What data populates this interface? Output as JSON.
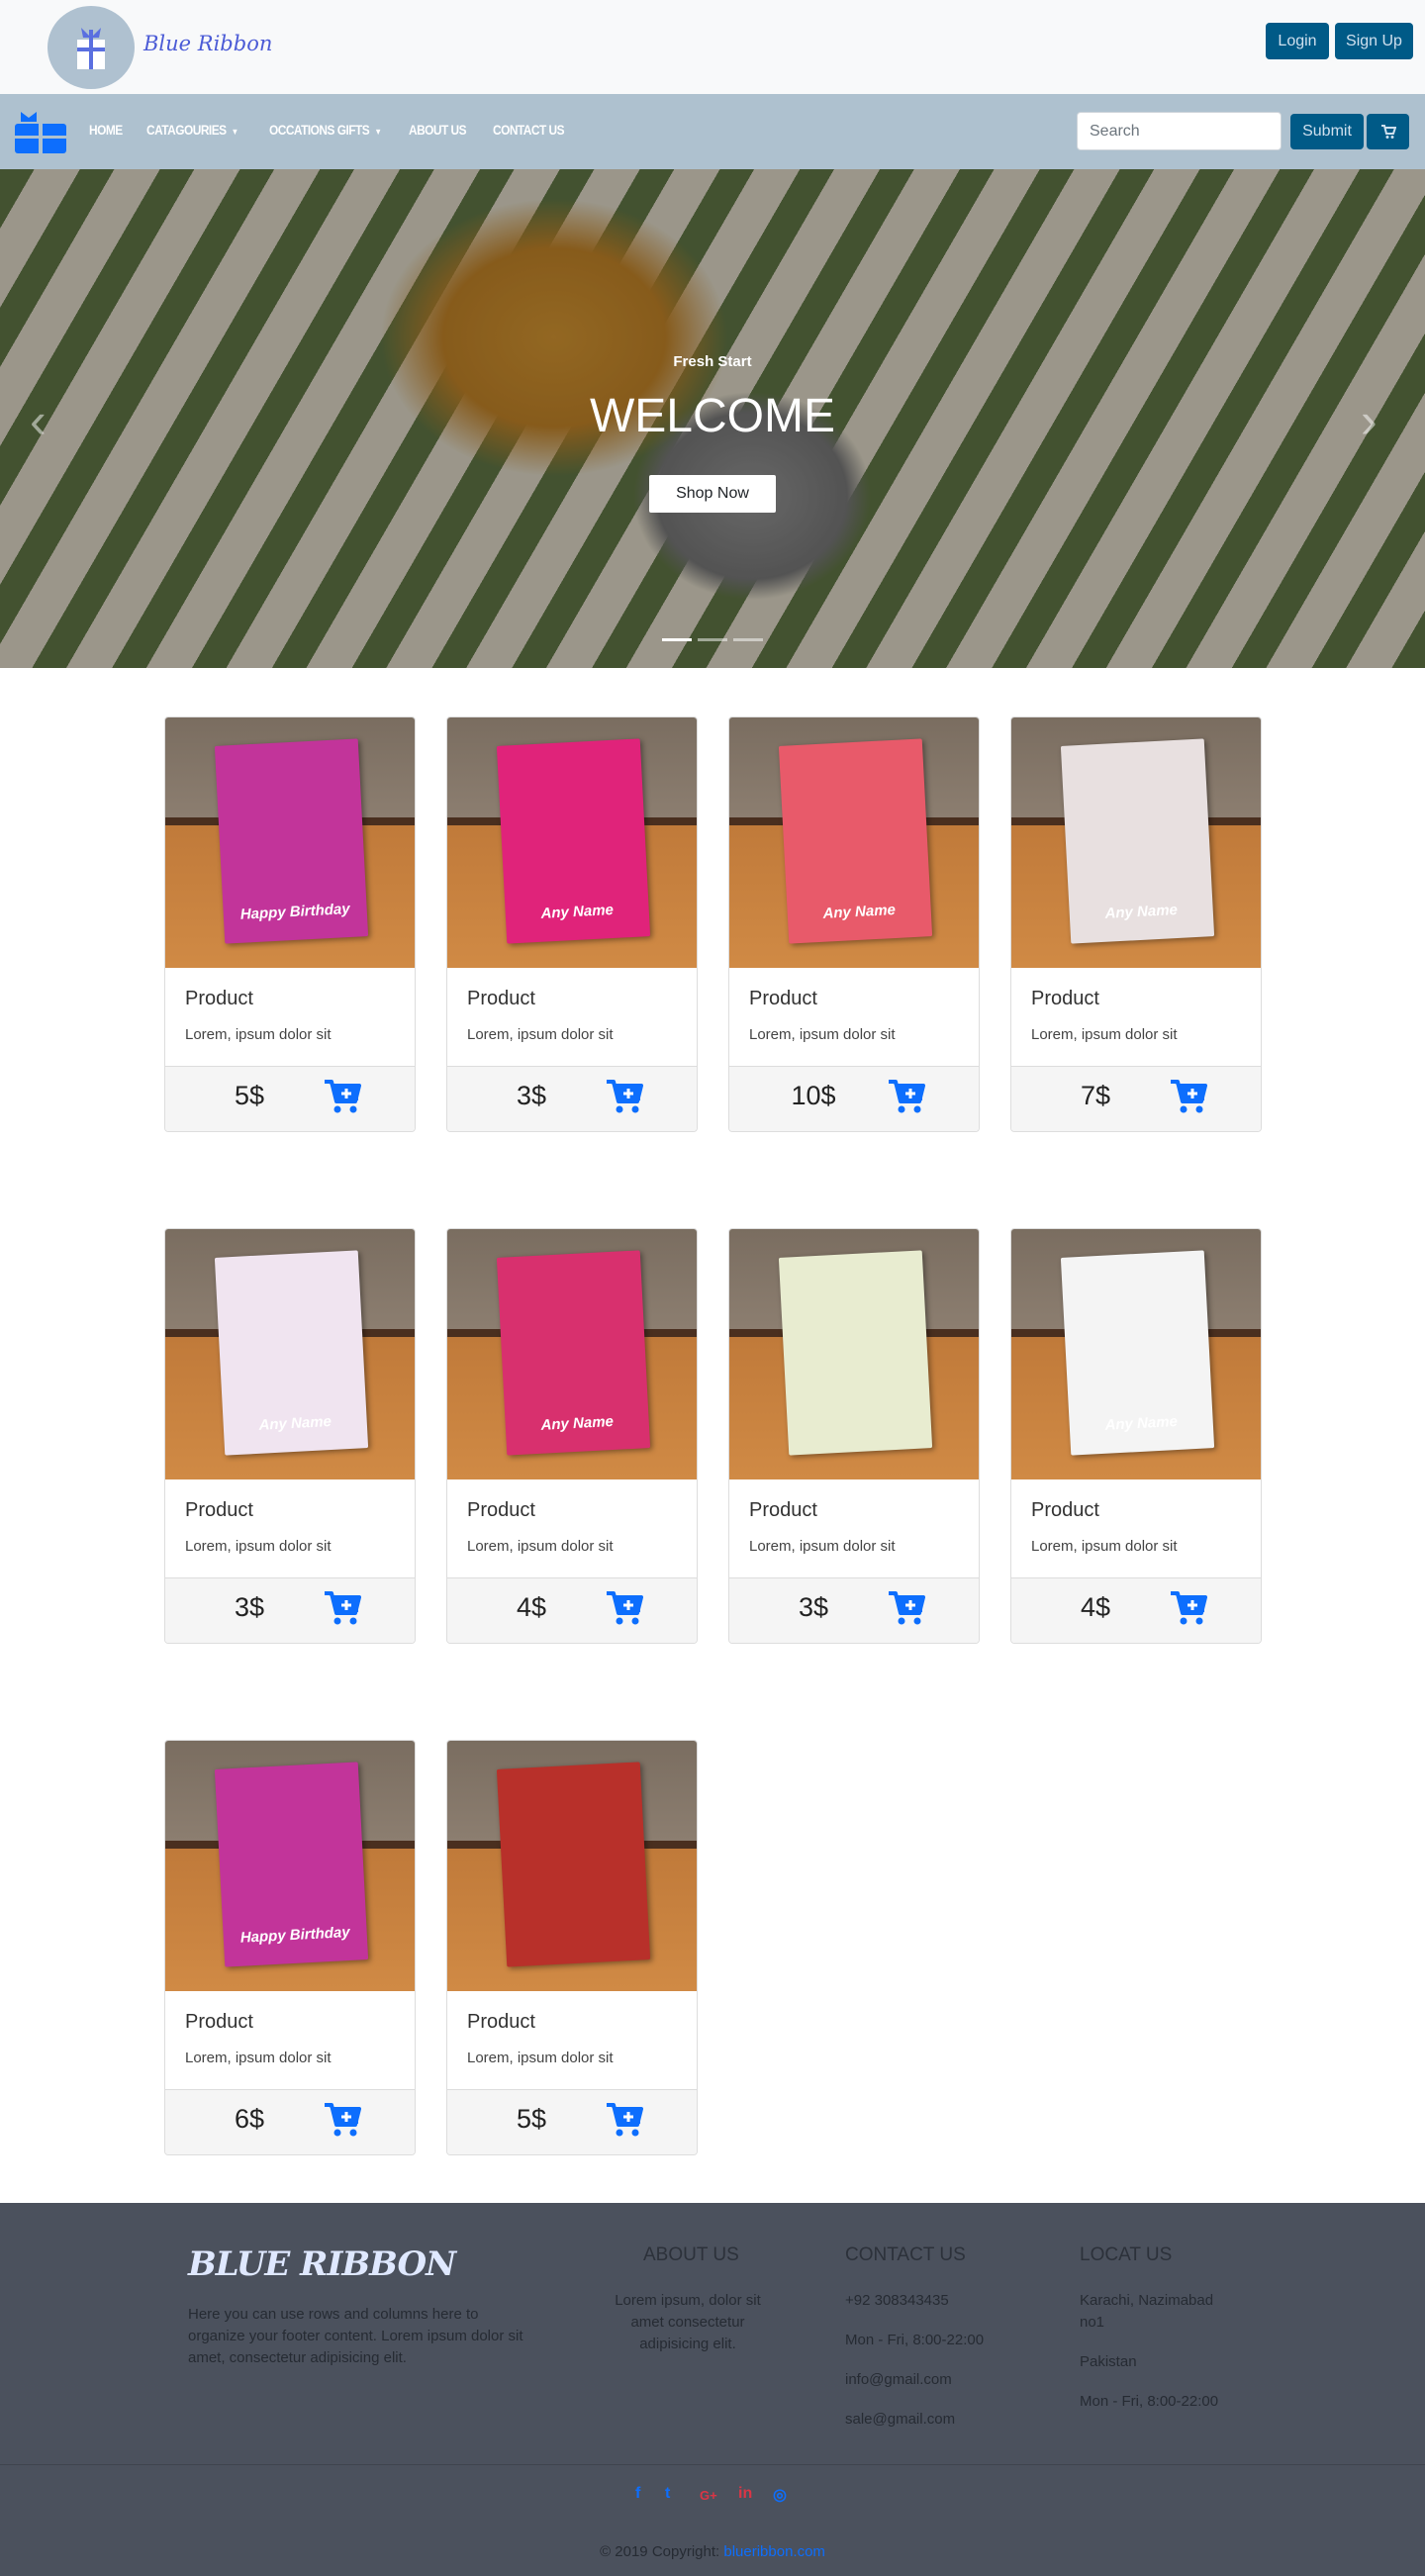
{
  "header": {
    "brand": "Blue Ribbon",
    "login": "Login",
    "signup": "Sign Up"
  },
  "nav": {
    "links": [
      "HOME",
      "CATAGOURIES",
      "OCCATIONS GIFTS",
      "ABOUT US",
      "CONTACT US"
    ],
    "search_placeholder": "Search",
    "submit": "Submit"
  },
  "hero": {
    "subtitle": "Fresh Start",
    "title": "WELCOME",
    "button": "Shop Now",
    "slides": 3,
    "active_slide": 1
  },
  "products": [
    {
      "title": "Product",
      "text": "Lorem, ipsum dolor sit",
      "price": "5$",
      "art": "Happy Birthday",
      "color": "#c2349a"
    },
    {
      "title": "Product",
      "text": "Lorem, ipsum dolor sit",
      "price": "3$",
      "art": "Any Name",
      "color": "#e0237a"
    },
    {
      "title": "Product",
      "text": "Lorem, ipsum dolor sit",
      "price": "10$",
      "art": "Any Name",
      "color": "#e85a6a"
    },
    {
      "title": "Product",
      "text": "Lorem, ipsum dolor sit",
      "price": "7$",
      "art": "Any Name",
      "color": "#e8e0e0"
    },
    {
      "title": "Product",
      "text": "Lorem, ipsum dolor sit",
      "price": "3$",
      "art": "Any Name",
      "color": "#f0e4f0"
    },
    {
      "title": "Product",
      "text": "Lorem, ipsum dolor sit",
      "price": "4$",
      "art": "Any Name",
      "color": "#d8306e"
    },
    {
      "title": "Product",
      "text": "Lorem, ipsum dolor sit",
      "price": "3$",
      "art": "",
      "color": "#e8ecd0"
    },
    {
      "title": "Product",
      "text": "Lorem, ipsum dolor sit",
      "price": "4$",
      "art": "Any Name",
      "color": "#f4f4f4"
    },
    {
      "title": "Product",
      "text": "Lorem, ipsum dolor sit",
      "price": "6$",
      "art": "Happy Birthday",
      "color": "#c2349a"
    },
    {
      "title": "Product",
      "text": "Lorem, ipsum dolor sit",
      "price": "5$",
      "art": "",
      "color": "#b8302a"
    }
  ],
  "footer": {
    "brand": "BLUE RIBBON",
    "description": "Here you can use rows and columns here to organize your footer content. Lorem ipsum dolor sit amet, consectetur adipisicing elit.",
    "about_heading": "ABOUT US",
    "about_text": "Lorem ipsum, dolor sit amet consectetur adipisicing elit.",
    "contact_heading": "CONTACT US",
    "contact": [
      "+92 308343435",
      "Mon - Fri, 8:00-22:00",
      "info@gmail.com",
      "sale@gmail.com"
    ],
    "locate_heading": "LOCAT US",
    "locate": [
      "Karachi, Nazimabad no1",
      "Pakistan",
      "Mon - Fri, 8:00-22:00"
    ],
    "social": [
      "f",
      "t",
      "G+",
      "in",
      "◎"
    ],
    "copyright": "© 2019 Copyright:",
    "copyright_link": "blueribbon.com"
  }
}
